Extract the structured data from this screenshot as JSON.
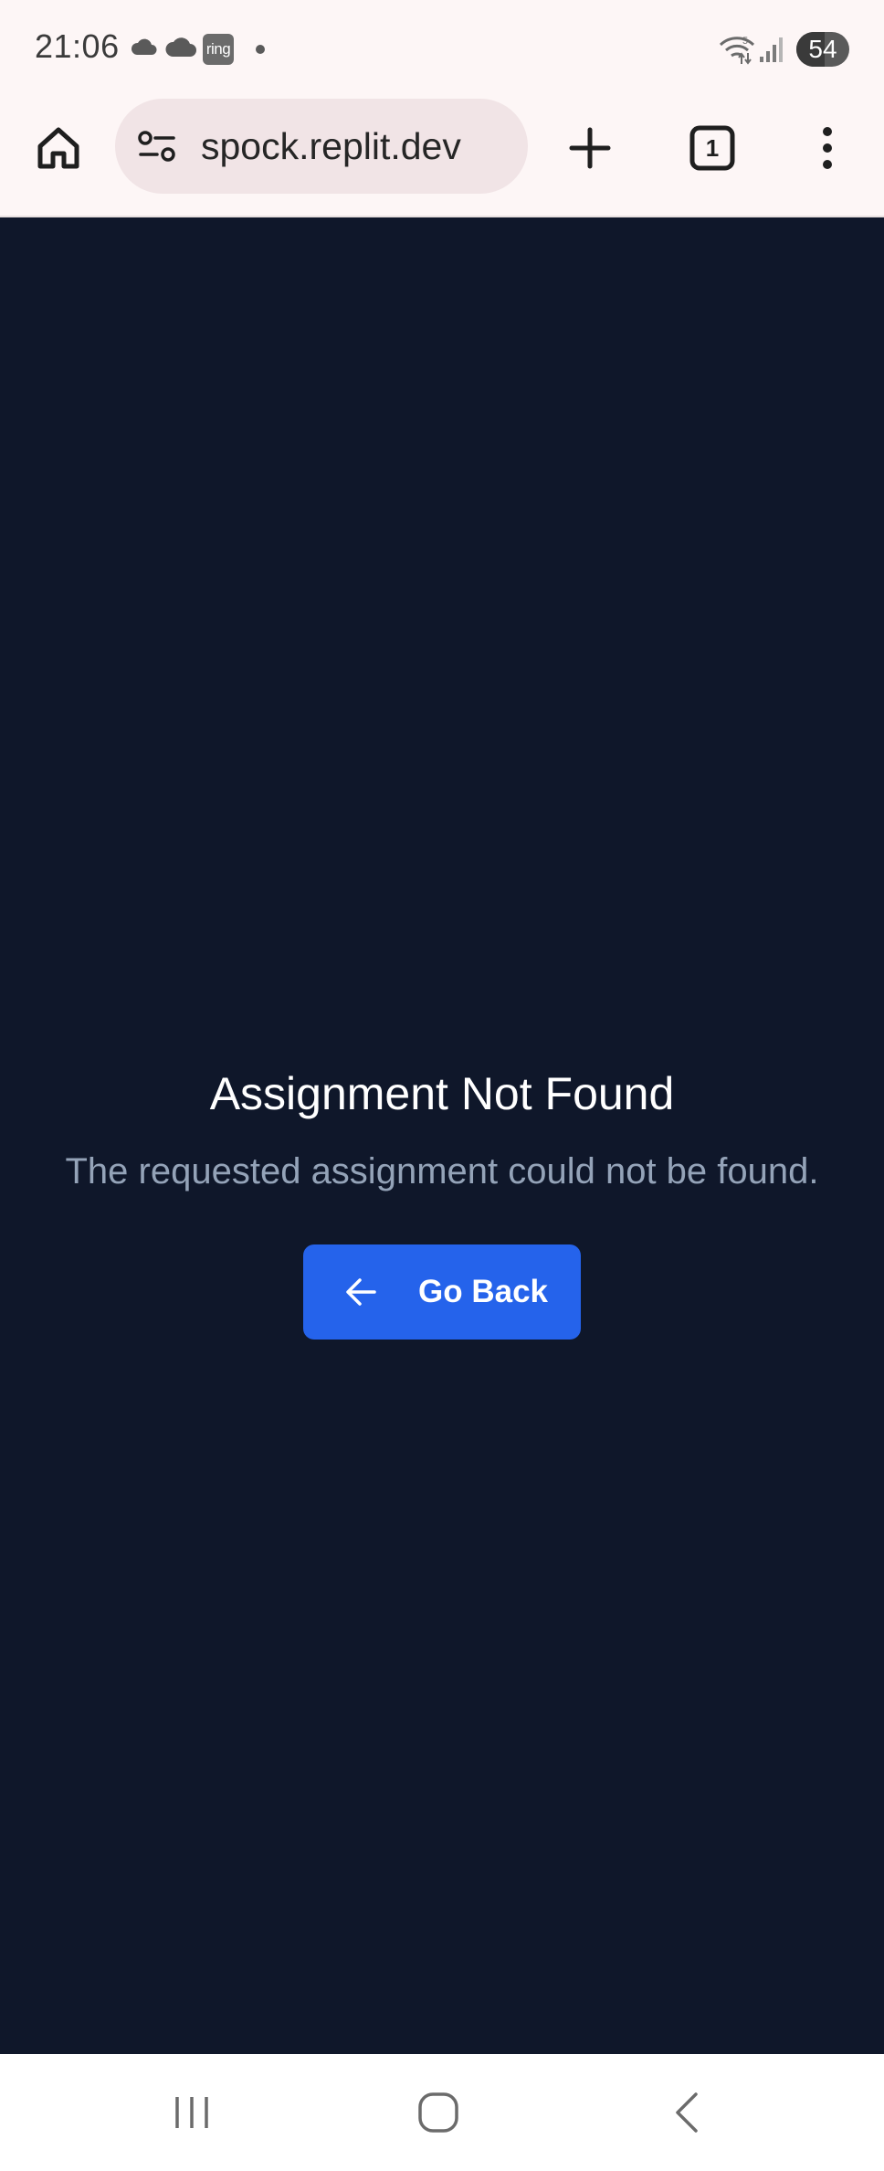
{
  "status_bar": {
    "time": "21:06",
    "ring_badge": "ring",
    "battery_level": "54",
    "icons": [
      "cloud-icon",
      "cloud-icon",
      "ring-app-icon",
      "dot-icon",
      "wifi-icon",
      "signal-icon",
      "battery-icon"
    ]
  },
  "browser": {
    "url": "spock.replit.dev",
    "tab_count": "1",
    "icons": [
      "home-icon",
      "site-settings-icon",
      "new-tab-icon",
      "tab-switcher-icon",
      "more-menu-icon"
    ]
  },
  "page": {
    "title": "Assignment Not Found",
    "message": "The requested assignment could not be found.",
    "back_button_label": "Go Back",
    "back_button_icon": "arrow-left-icon"
  },
  "nav_bar": {
    "icons": [
      "recent-apps-icon",
      "home-nav-icon",
      "back-nav-icon"
    ]
  },
  "colors": {
    "page_background": "#0f172a",
    "title_text": "#ffffff",
    "message_text": "#94a3b8",
    "button_primary": "#2563eb",
    "browser_chrome": "#fdf6f6",
    "url_pill": "#f1e4e6"
  }
}
